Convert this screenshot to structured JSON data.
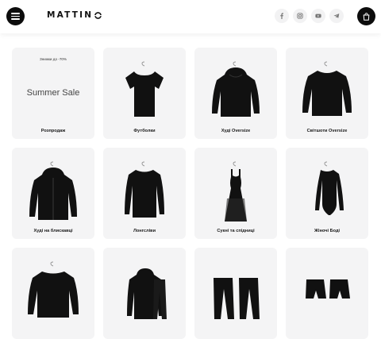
{
  "header": {
    "brand": "MATTIN",
    "socials": [
      "facebook-icon",
      "instagram-icon",
      "youtube-icon",
      "telegram-icon"
    ]
  },
  "sale": {
    "note": "Знижки до -70%",
    "title": "Summer Sale"
  },
  "categories": [
    {
      "label": "Розпродаж",
      "icon": "sale"
    },
    {
      "label": "Футболки",
      "icon": "tshirt"
    },
    {
      "label": "Худі Oversize",
      "icon": "hoodie"
    },
    {
      "label": "Світшоти Oversize",
      "icon": "sweatshirt"
    },
    {
      "label": "Худі на блискавці",
      "icon": "zip-hoodie"
    },
    {
      "label": "Лонгсліви",
      "icon": "longsleeve"
    },
    {
      "label": "Сукні та спідниці",
      "icon": "dress"
    },
    {
      "label": "Жіночі Боді",
      "icon": "bodysuit"
    },
    {
      "label": "",
      "icon": "sweater"
    },
    {
      "label": "",
      "icon": "tracksuit"
    },
    {
      "label": "",
      "icon": "pants"
    },
    {
      "label": "",
      "icon": "shorts"
    }
  ]
}
